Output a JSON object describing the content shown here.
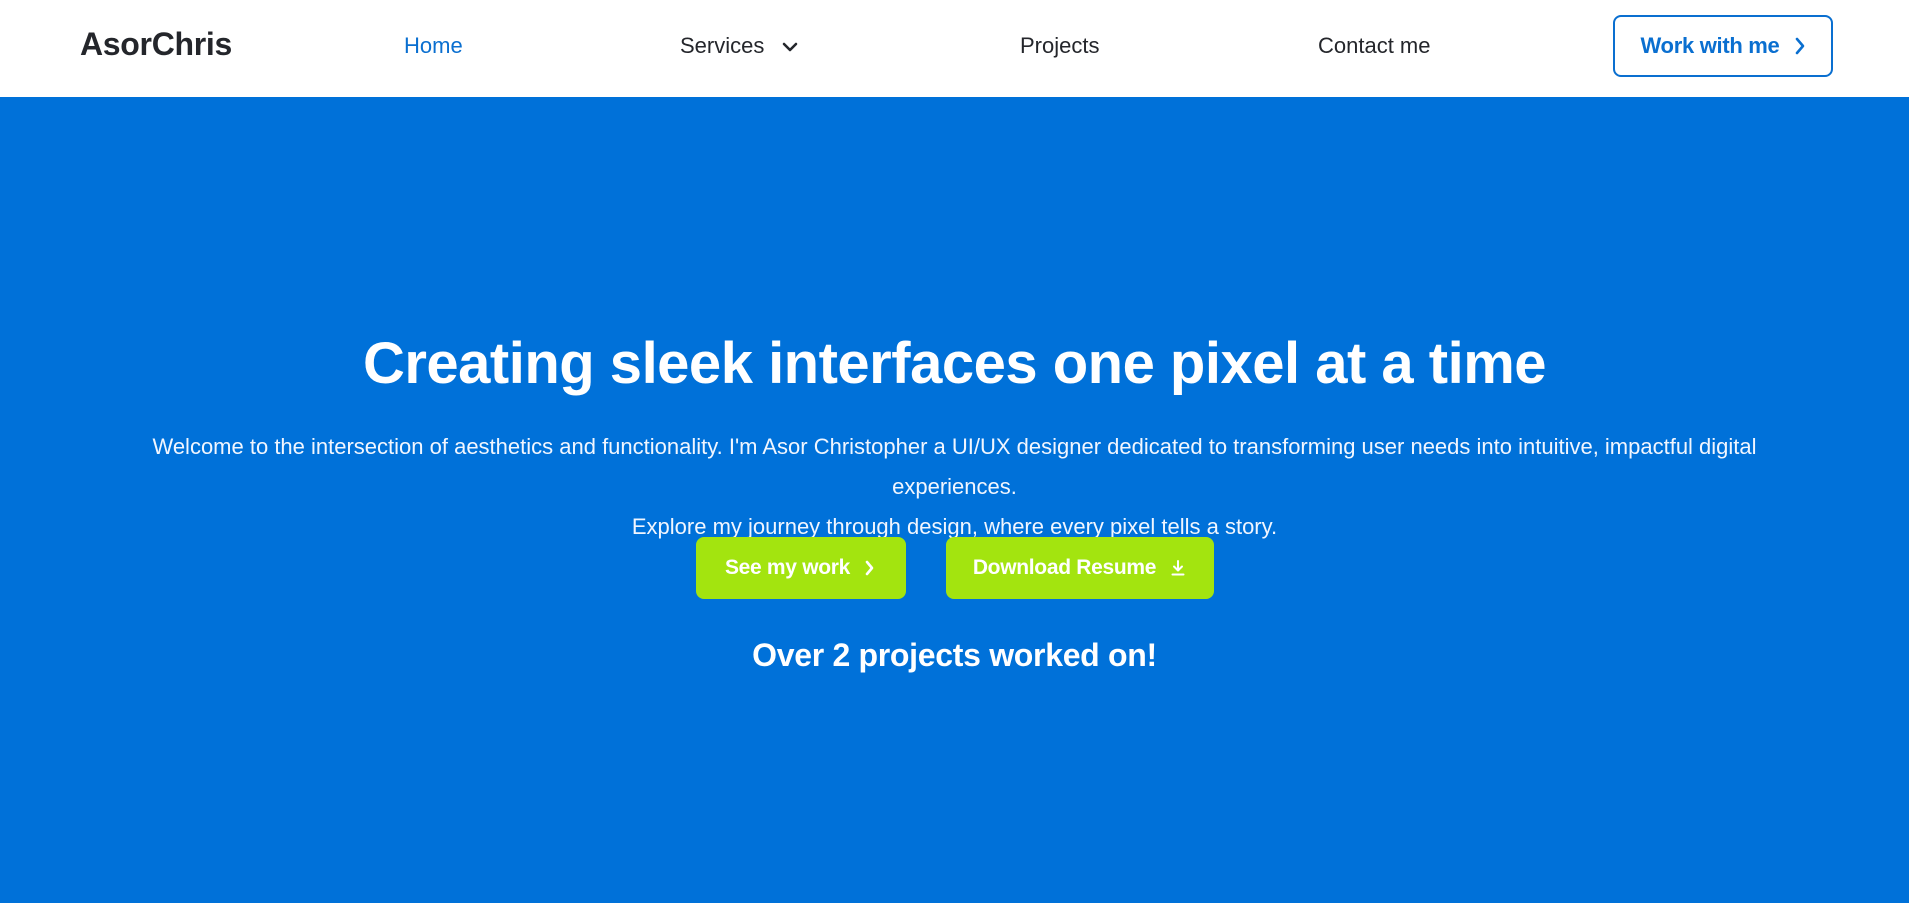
{
  "brand": {
    "name": "AsorChris"
  },
  "nav": {
    "home": "Home",
    "services": "Services",
    "projects": "Projects",
    "contact": "Contact me",
    "cta_label": "Work with me",
    "cta_icon": "chevron-right-icon",
    "services_icon": "chevron-down-icon",
    "active_color": "#0a6fd0"
  },
  "hero": {
    "title": "Creating sleek interfaces one pixel at a time",
    "subtitle_line1": "Welcome to the intersection of aesthetics and functionality. I'm Asor Christopher a UI/UX designer dedicated to transforming user needs into intuitive, impactful digital experiences.",
    "subtitle_line2": "Explore my journey through design, where every pixel tells a story.",
    "primary_button": "See my work",
    "primary_icon": "chevron-right-icon",
    "secondary_button": "Download Resume",
    "secondary_icon": "download-icon",
    "stat": "Over 2 projects worked on!",
    "background_color": "#0071d9",
    "button_color": "#a3e40f"
  }
}
